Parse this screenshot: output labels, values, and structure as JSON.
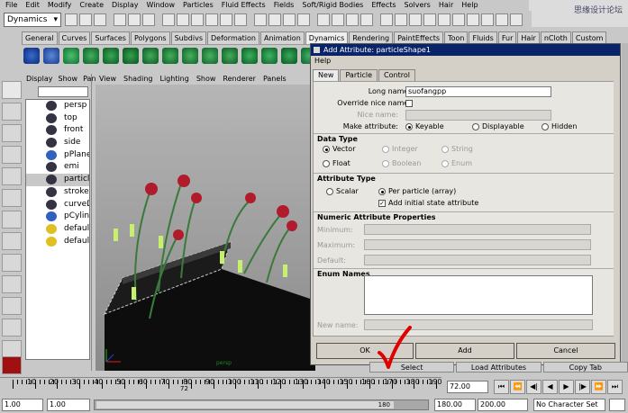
{
  "menubar": [
    "File",
    "Edit",
    "Modify",
    "Create",
    "Display",
    "Window",
    "Particles",
    "Fluid Effects",
    "Fields",
    "Soft/Rigid Bodies",
    "Effects",
    "Solvers",
    "Hair",
    "Help"
  ],
  "logo_text": "思缘设计论坛",
  "mode_selector": "Dynamics",
  "shelf_tabs": [
    "General",
    "Curves",
    "Surfaces",
    "Polygons",
    "Subdivs",
    "Deformation",
    "Animation",
    "Dynamics",
    "Rendering",
    "PaintEffects",
    "Toon",
    "Fluids",
    "Fur",
    "Hair",
    "nCloth",
    "Custom"
  ],
  "active_shelf_tab": "Dynamics",
  "outliner": {
    "menu": [
      "Display",
      "Show",
      "Panels"
    ],
    "items": [
      "persp",
      "top",
      "front",
      "side",
      "pPlane1",
      "emi",
      "particle",
      "strokeD",
      "curveD",
      "pCylind",
      "default",
      "default"
    ],
    "selected_index": 6
  },
  "viewport": {
    "menu": [
      "View",
      "Shading",
      "Lighting",
      "Show",
      "Renderer",
      "Panels"
    ],
    "axis_label": "persp"
  },
  "dialog": {
    "title": "Add Attribute: particleShape1",
    "help_menu": "Help",
    "tabs": [
      "New",
      "Particle",
      "Control"
    ],
    "long_name_label": "Long name:",
    "long_name_value": "suofangpp",
    "override_label": "Override nice name:",
    "nice_name_label": "Nice name:",
    "make_attr_label": "Make attribute:",
    "make_attr_options": [
      "Keyable",
      "Displayable",
      "Hidden"
    ],
    "data_type_title": "Data Type",
    "data_types": [
      "Vector",
      "Integer",
      "String",
      "Float",
      "Boolean",
      "Enum"
    ],
    "attr_type_title": "Attribute Type",
    "attr_types": [
      "Scalar",
      "Per particle (array)"
    ],
    "initial_state_label": "Add initial state attribute",
    "numeric_title": "Numeric Attribute Properties",
    "numeric_labels": [
      "Minimum:",
      "Maximum:",
      "Default:"
    ],
    "enum_title": "Enum Names",
    "new_name_label": "New name:",
    "buttons": {
      "ok": "OK",
      "add": "Add",
      "cancel": "Cancel"
    }
  },
  "bottom_buttons": [
    "Select",
    "Load Attributes",
    "Copy Tab"
  ],
  "timeline": {
    "ticks": [
      "10",
      "20",
      "30",
      "40",
      "50",
      "60",
      "70",
      "80",
      "90",
      "100",
      "110",
      "120",
      "130",
      "140",
      "150",
      "160",
      "170",
      "180",
      "190"
    ],
    "current_frame_marker": "72",
    "current_frame": "72.00"
  },
  "range": {
    "start": "1.00",
    "playback_start": "1.00",
    "slider_end_label": "180",
    "playback_end": "180.00",
    "end": "200.00",
    "character_set": "No Character Set"
  },
  "colors": {
    "title_bar": "#0a246a",
    "dialog_bg": "#d4d0c8",
    "annotation": "#e00000"
  }
}
